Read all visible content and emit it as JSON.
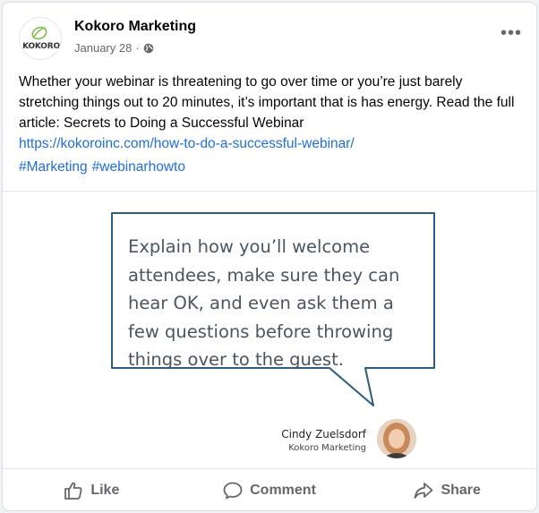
{
  "post": {
    "page_name": "Kokoro Marketing",
    "avatar_text": "KOKORO",
    "date": "January 28",
    "separator": "·",
    "privacy_icon": "globe-icon",
    "more_label": "•••",
    "body": "Whether your webinar is threatening to go over time or you’re just barely stretching things out to 20 minutes, it’s important that is has energy. Read the full article: Secrets to Doing a Successful Webinar",
    "link": "https://kokoroinc.com/how-to-do-a-successful-webinar/",
    "hashtags": [
      "#Marketing",
      "#webinarhowto"
    ]
  },
  "image": {
    "quote_lines": [
      "Explain how you’ll welcome",
      "attendees, make sure they can",
      "hear OK, and even ask them a",
      "few questions before throwing",
      "things over to the guest."
    ],
    "author_name": "Cindy Zuelsdorf",
    "author_org": "Kokoro Marketing",
    "bubble_color": "#2e5c7e"
  },
  "actions": {
    "like": "Like",
    "comment": "Comment",
    "share": "Share"
  },
  "colors": {
    "link": "#216fdb",
    "secondary_text": "#65676b",
    "avatar_green": "#7bbf44"
  }
}
